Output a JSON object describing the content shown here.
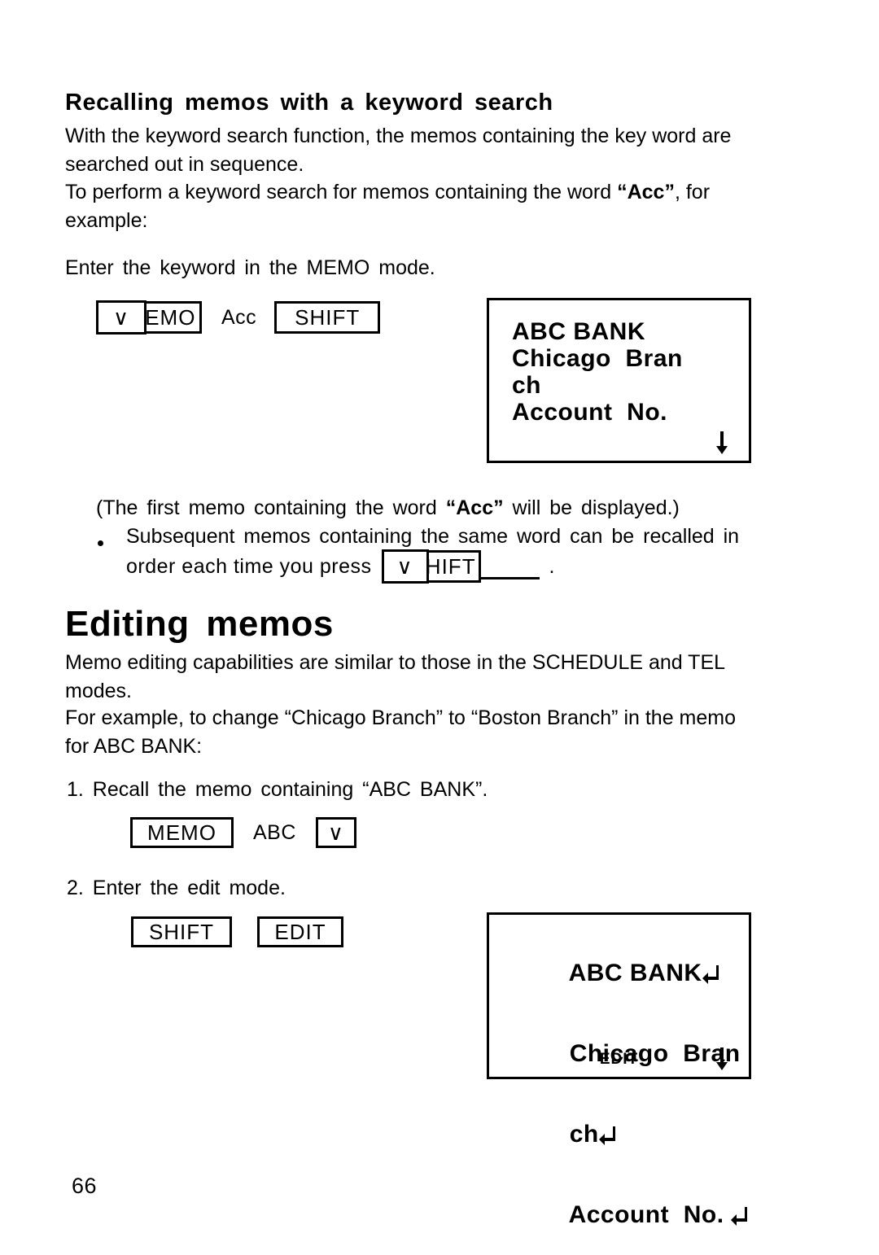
{
  "page": {
    "number": "66"
  },
  "section1": {
    "heading": "Recalling memos with a keyword search",
    "para1": "With the keyword search function, the memos containing the key word are",
    "para1_last": "searched out in sequence.",
    "para2_pre": "To perform a keyword search for memos containing the word ",
    "para2_quote": "“Acc”",
    "para2_post": ", for",
    "para2_last": "example:",
    "instruction": "Enter the keyword in the MEMO mode.",
    "keys": {
      "chevron": "∨",
      "memo": "MEMO",
      "typed": "Acc",
      "shift": "SHIFT"
    },
    "note_pre": "(The first memo containing the word ",
    "note_quote": "“Acc”",
    "note_post": " will be displayed.)",
    "bullet_line1": "Subsequent memos containing the same word can be recalled in",
    "bullet_line2_pre": "order each time you press",
    "bullet_line2_post": ".",
    "bullet_keys": {
      "chevron": "∨",
      "shift": "SHIFT"
    }
  },
  "lcd1": {
    "lines": [
      "ABC BANK",
      "Chicago  Bran",
      "ch",
      "Account  No."
    ],
    "status": "",
    "arrow_icon": "down-arrow-icon"
  },
  "section2": {
    "heading": "Editing memos",
    "para1": "Memo editing capabilities are similar to those in the SCHEDULE and TEL",
    "para1_last": "modes.",
    "para2": "For example, to change “Chicago Branch” to “Boston Branch” in the memo",
    "para2_last": "for ABC BANK:",
    "step1": {
      "text": "1. Recall the memo containing “ABC BANK”.",
      "keys": {
        "memo": "MEMO",
        "typed": "ABC",
        "chevron": "∨"
      }
    },
    "step2": {
      "text": "2. Enter the edit mode.",
      "keys": {
        "shift": "SHIFT",
        "edit": "EDIT"
      }
    }
  },
  "lcd2": {
    "lines": [
      {
        "text": "ABC BANK",
        "ret": true
      },
      {
        "text": "Chicago  Bran",
        "ret": false
      },
      {
        "text": "ch",
        "ret": true
      },
      {
        "text": "Account  No. ",
        "ret": true
      }
    ],
    "status": "EDIT",
    "arrow_icon": "down-arrow-icon",
    "return_icon": "carriage-return-icon"
  }
}
